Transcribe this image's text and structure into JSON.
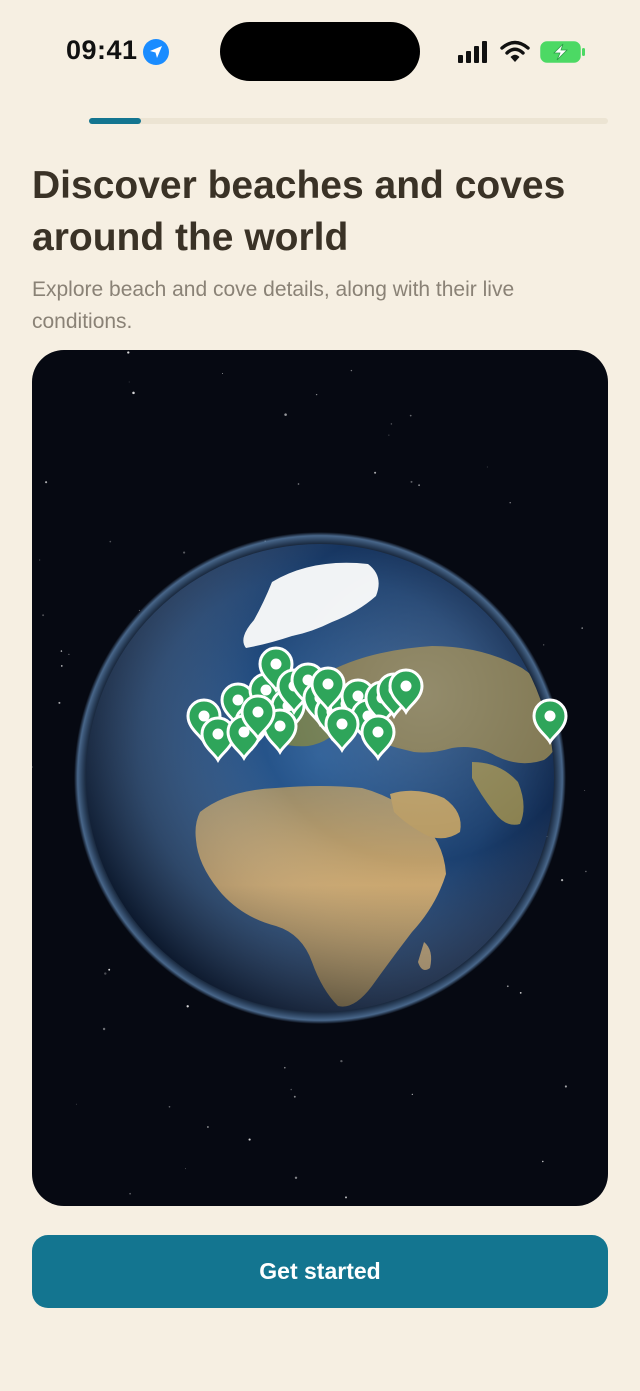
{
  "status_bar": {
    "time": "09:41",
    "icons": [
      "location-arrow-icon",
      "signal-icon",
      "wifi-icon",
      "battery-charging-icon"
    ]
  },
  "onboarding": {
    "progress": 0.1,
    "title": "Discover beaches and coves around the world",
    "subtitle": "Explore beach and cove details, along with their live conditions."
  },
  "globe": {
    "pin_icon": "map-pin-icon",
    "pin_color": "#2ea55a",
    "ocean_color": "#1f4a80",
    "space_color": "#060912"
  },
  "cta": {
    "label": "Get started"
  },
  "colors": {
    "background": "#f6efe2",
    "accent": "#137590",
    "title": "#3a3226",
    "subtitle": "#8a8276"
  }
}
